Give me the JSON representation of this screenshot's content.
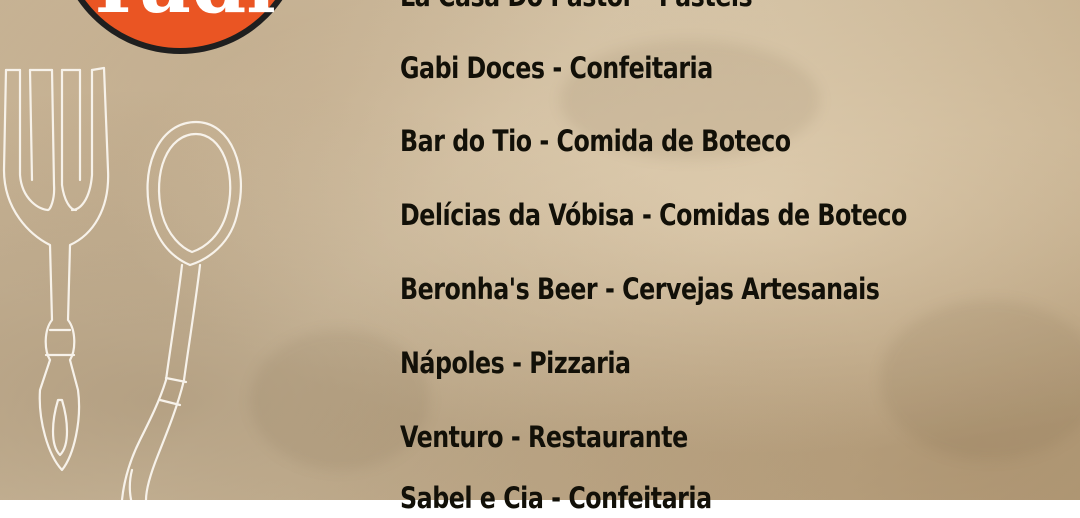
{
  "logo": {
    "text": "Tudi",
    "colors": {
      "fill": "#ea5523",
      "ring": "#1f1f1f",
      "text": "#ffffff"
    }
  },
  "decoration": {
    "icons": [
      "fork-icon",
      "spoon-icon"
    ],
    "stroke_color": "#f7f2ea"
  },
  "menu": {
    "text_color": "#121008",
    "items": [
      {
        "label": "La Casa Do Pastor - Pastéis"
      },
      {
        "label": "Gabi Doces - Confeitaria"
      },
      {
        "label": "Bar do Tio - Comida de Boteco"
      },
      {
        "label": "Delícias da Vóbisa - Comidas de Boteco"
      },
      {
        "label": "Beronha's Beer - Cervejas Artesanais"
      },
      {
        "label": "Nápoles - Pizzaria"
      },
      {
        "label": "Venturo - Restaurante"
      },
      {
        "label": "Sabel e Cia - Confeitaria"
      }
    ]
  },
  "background": {
    "base_color": "#cdb999"
  }
}
